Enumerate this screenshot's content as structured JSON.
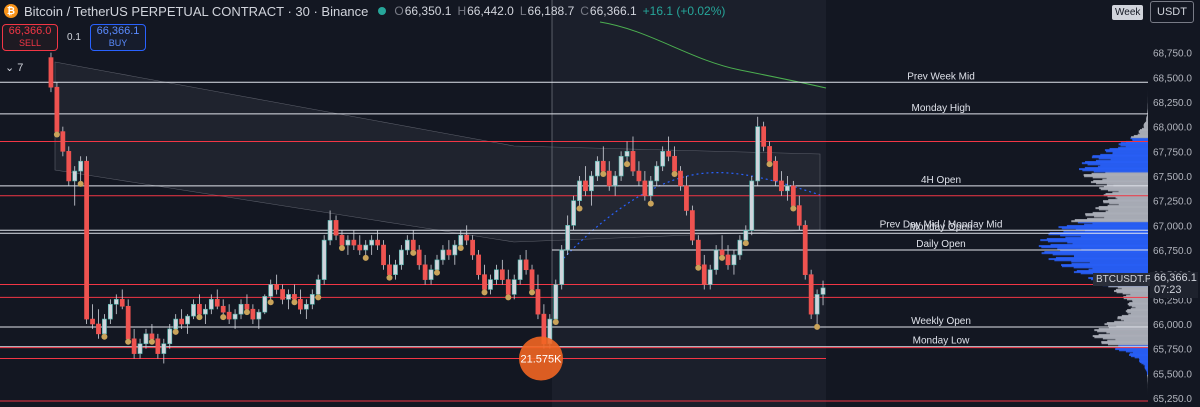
{
  "header": {
    "coin_glyph": "₿",
    "title": "Bitcoin / TetherUS PERPETUAL CONTRACT · 30 · Binance",
    "open_key": "O",
    "open": "66,350.1",
    "high_key": "H",
    "high": "66,442.0",
    "low_key": "L",
    "low": "66,188.7",
    "close_key": "C",
    "close": "66,366.1",
    "change": "+16.1 (+0.02%)"
  },
  "trade": {
    "sell_price": "66,366.0",
    "sell_label": "SELL",
    "quantity": "0.1",
    "buy_price": "66,366.1",
    "buy_label": "BUY"
  },
  "indicators_toggle": "⌄ 7",
  "timeframe_tag": "Week",
  "currency": "USDT",
  "last_price": {
    "symbol": "BTCUSDT.P",
    "price": "66,366.1",
    "countdown": "07:23"
  },
  "colors": {
    "bg": "#131722",
    "up": "#26a69a",
    "down": "#ef5350",
    "white_line": "#e0e3eb",
    "red_line": "#f23645",
    "marker": "#c9a35a",
    "vp_blue": "#2962ff",
    "vp_white": "#b2b5be",
    "orange_bubble": "#f26522"
  },
  "chart_data": {
    "type": "candlestick",
    "instrument": "BTCUSDT.P",
    "interval": "30",
    "ylim": [
      65250,
      69000
    ],
    "y_ticks": [
      "68,750.0",
      "68,500.0",
      "68,250.0",
      "68,000.0",
      "67,750.0",
      "67,500.0",
      "67,250.0",
      "67,000.0",
      "66,750.0",
      "66,500.0",
      "66,250.0",
      "66,000.0",
      "65,750.0",
      "65,500.0",
      "65,250.0"
    ],
    "candles": [
      [
        68700,
        68750,
        68350,
        68400
      ],
      [
        68400,
        68450,
        67900,
        67950
      ],
      [
        67950,
        68000,
        67700,
        67750
      ],
      [
        67750,
        67800,
        67400,
        67450
      ],
      [
        67450,
        67600,
        67200,
        67550
      ],
      [
        67550,
        67700,
        67400,
        67650
      ],
      [
        67650,
        67700,
        66000,
        66050
      ],
      [
        66050,
        66200,
        65950,
        66000
      ],
      [
        66000,
        66150,
        65850,
        65900
      ],
      [
        65900,
        66100,
        65850,
        66050
      ],
      [
        66050,
        66250,
        66000,
        66200
      ],
      [
        66200,
        66300,
        66100,
        66250
      ],
      [
        66250,
        66350,
        66150,
        66180
      ],
      [
        66180,
        66250,
        65800,
        65850
      ],
      [
        65850,
        65950,
        65650,
        65700
      ],
      [
        65700,
        65850,
        65650,
        65800
      ],
      [
        65800,
        65950,
        65750,
        65900
      ],
      [
        65900,
        66000,
        65800,
        65850
      ],
      [
        65850,
        65900,
        65650,
        65700
      ],
      [
        65700,
        65850,
        65600,
        65800
      ],
      [
        65800,
        66000,
        65750,
        65950
      ],
      [
        65950,
        66100,
        65900,
        66050
      ],
      [
        66050,
        66150,
        65950,
        66000
      ],
      [
        66000,
        66100,
        65900,
        66080
      ],
      [
        66080,
        66250,
        66050,
        66200
      ],
      [
        66200,
        66300,
        66050,
        66100
      ],
      [
        66100,
        66200,
        66000,
        66150
      ],
      [
        66150,
        66300,
        66100,
        66250
      ],
      [
        66250,
        66350,
        66150,
        66180
      ],
      [
        66180,
        66250,
        66050,
        66120
      ],
      [
        66120,
        66200,
        66000,
        66050
      ],
      [
        66050,
        66150,
        65950,
        66100
      ],
      [
        66100,
        66250,
        66050,
        66200
      ],
      [
        66200,
        66300,
        66100,
        66150
      ],
      [
        66150,
        66200,
        66000,
        66050
      ],
      [
        66050,
        66150,
        65950,
        66120
      ],
      [
        66120,
        66300,
        66100,
        66280
      ],
      [
        66280,
        66450,
        66200,
        66400
      ],
      [
        66400,
        66500,
        66300,
        66350
      ],
      [
        66350,
        66400,
        66200,
        66250
      ],
      [
        66250,
        66350,
        66150,
        66300
      ],
      [
        66300,
        66400,
        66200,
        66250
      ],
      [
        66250,
        66350,
        66100,
        66150
      ],
      [
        66150,
        66250,
        66050,
        66200
      ],
      [
        66200,
        66350,
        66150,
        66300
      ],
      [
        66300,
        66500,
        66250,
        66450
      ],
      [
        66450,
        66900,
        66400,
        66850
      ],
      [
        66850,
        67150,
        66800,
        67050
      ],
      [
        67050,
        67100,
        66850,
        66900
      ],
      [
        66900,
        66950,
        66750,
        66800
      ],
      [
        66800,
        66900,
        66700,
        66850
      ],
      [
        66850,
        66950,
        66750,
        66800
      ],
      [
        66800,
        66900,
        66700,
        66750
      ],
      [
        66750,
        66850,
        66650,
        66800
      ],
      [
        66800,
        66900,
        66700,
        66850
      ],
      [
        66850,
        66950,
        66750,
        66800
      ],
      [
        66800,
        66850,
        66550,
        66600
      ],
      [
        66600,
        66700,
        66450,
        66500
      ],
      [
        66500,
        66650,
        66450,
        66600
      ],
      [
        66600,
        66800,
        66550,
        66750
      ],
      [
        66750,
        66900,
        66700,
        66850
      ],
      [
        66850,
        66950,
        66700,
        66750
      ],
      [
        66750,
        66800,
        66550,
        66600
      ],
      [
        66600,
        66700,
        66400,
        66450
      ],
      [
        66450,
        66600,
        66400,
        66550
      ],
      [
        66550,
        66700,
        66500,
        66650
      ],
      [
        66650,
        66800,
        66600,
        66750
      ],
      [
        66750,
        66850,
        66650,
        66700
      ],
      [
        66700,
        66850,
        66600,
        66800
      ],
      [
        66800,
        66950,
        66750,
        66900
      ],
      [
        66900,
        67000,
        66800,
        66850
      ],
      [
        66850,
        66900,
        66650,
        66700
      ],
      [
        66700,
        66750,
        66450,
        66500
      ],
      [
        66500,
        66600,
        66300,
        66350
      ],
      [
        66350,
        66500,
        66300,
        66450
      ],
      [
        66450,
        66600,
        66400,
        66550
      ],
      [
        66550,
        66650,
        66400,
        66450
      ],
      [
        66450,
        66550,
        66250,
        66300
      ],
      [
        66300,
        66500,
        66250,
        66450
      ],
      [
        66450,
        66700,
        66400,
        66650
      ],
      [
        66650,
        66750,
        66500,
        66550
      ],
      [
        66550,
        66600,
        66300,
        66350
      ],
      [
        66350,
        66500,
        66050,
        66100
      ],
      [
        66100,
        66200,
        65750,
        65800
      ],
      [
        65800,
        66100,
        65750,
        66050
      ],
      [
        66050,
        66450,
        66000,
        66400
      ],
      [
        66400,
        66800,
        66350,
        66750
      ],
      [
        66750,
        67100,
        66700,
        67000
      ],
      [
        67000,
        67300,
        66950,
        67250
      ],
      [
        67250,
        67500,
        67150,
        67450
      ],
      [
        67450,
        67600,
        67300,
        67350
      ],
      [
        67350,
        67550,
        67200,
        67500
      ],
      [
        67500,
        67700,
        67450,
        67650
      ],
      [
        67650,
        67800,
        67500,
        67550
      ],
      [
        67550,
        67650,
        67350,
        67400
      ],
      [
        67400,
        67550,
        67300,
        67500
      ],
      [
        67500,
        67750,
        67450,
        67700
      ],
      [
        67700,
        67850,
        67600,
        67750
      ],
      [
        67750,
        67900,
        67500,
        67550
      ],
      [
        67550,
        67650,
        67400,
        67450
      ],
      [
        67450,
        67550,
        67250,
        67300
      ],
      [
        67300,
        67500,
        67200,
        67450
      ],
      [
        67450,
        67650,
        67400,
        67600
      ],
      [
        67600,
        67800,
        67550,
        67750
      ],
      [
        67750,
        67900,
        67650,
        67700
      ],
      [
        67700,
        67800,
        67500,
        67550
      ],
      [
        67550,
        67600,
        67350,
        67400
      ],
      [
        67400,
        67500,
        67100,
        67150
      ],
      [
        67150,
        67200,
        66800,
        66850
      ],
      [
        66850,
        66900,
        66550,
        66600
      ],
      [
        66600,
        66700,
        66350,
        66400
      ],
      [
        66400,
        66600,
        66350,
        66550
      ],
      [
        66550,
        66800,
        66500,
        66750
      ],
      [
        66750,
        66900,
        66650,
        66700
      ],
      [
        66700,
        66800,
        66550,
        66600
      ],
      [
        66600,
        66750,
        66500,
        66700
      ],
      [
        66700,
        66900,
        66650,
        66850
      ],
      [
        66850,
        67000,
        66800,
        66950
      ],
      [
        66950,
        67500,
        66900,
        67450
      ],
      [
        67450,
        68100,
        67400,
        68000
      ],
      [
        68000,
        68050,
        67750,
        67800
      ],
      [
        67800,
        67850,
        67600,
        67650
      ],
      [
        67650,
        67700,
        67400,
        67450
      ],
      [
        67450,
        67550,
        67300,
        67350
      ],
      [
        67350,
        67500,
        67250,
        67400
      ],
      [
        67400,
        67450,
        67150,
        67200
      ],
      [
        67200,
        67300,
        66950,
        67000
      ],
      [
        67000,
        67050,
        66450,
        66500
      ],
      [
        66500,
        66550,
        66050,
        66100
      ],
      [
        66100,
        66350,
        65950,
        66300
      ],
      [
        66300,
        66440,
        66190,
        66366
      ]
    ],
    "levels": [
      {
        "label": "Prev Week Mid",
        "price": 68450,
        "color": "white"
      },
      {
        "label": "Monday High",
        "price": 68130,
        "color": "white"
      },
      {
        "label": "4H Open",
        "price": 67400,
        "color": "white"
      },
      {
        "label": "Prev Day Mid / Monday Mid",
        "price": 66950,
        "color": "white"
      },
      {
        "label": "Monday Open",
        "price": 66920,
        "color": "white"
      },
      {
        "label": "Daily Open",
        "price": 66750,
        "color": "white"
      },
      {
        "label": "Weekly Open",
        "price": 65970,
        "color": "white"
      },
      {
        "label": "Monday Low",
        "price": 65770,
        "color": "white"
      },
      {
        "price": 67850,
        "color": "red"
      },
      {
        "price": 67300,
        "color": "red"
      },
      {
        "price": 66400,
        "color": "red"
      },
      {
        "price": 66270,
        "color": "red"
      },
      {
        "price": 65760,
        "color": "red"
      },
      {
        "price": 65650,
        "color": "red"
      },
      {
        "price": 65220,
        "color": "red"
      }
    ],
    "bubble": {
      "label": "21.575K",
      "price": 65650
    },
    "last_price": 66366.1
  }
}
